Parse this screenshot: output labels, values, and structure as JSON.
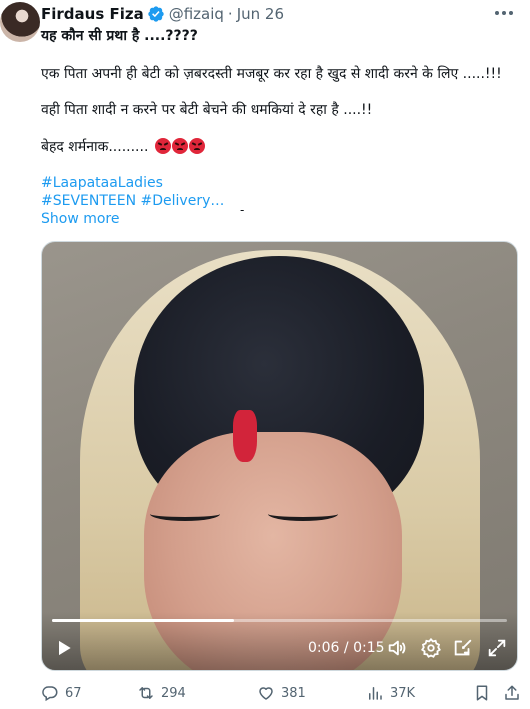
{
  "tweet": {
    "author_name": "Firdaus Fiza",
    "handle": "@fizaiq",
    "separator": "·",
    "date": "Jun 26",
    "line1": "यह कौन सी प्रथा  है ....????",
    "line2": "एक पिता अपनी ही बेटी को ज़बरदस्ती मजबूर कर रहा है खुद से शादी करने के लिए .....!!!",
    "line3": "वही पिता शादी न करने पर बेटी बेचने की धमकियां दे रहा है ....!!",
    "line4": "बेहद शर्मनाक.........",
    "hashtags_line1": "#LaapataaLadies",
    "hashtags_line2": "#SEVENTEEN #Delivery…",
    "show_more": "Show more",
    "stray_mark": "-"
  },
  "video": {
    "current_time": "0:06",
    "time_separator": " / ",
    "duration": "0:15",
    "progress_fraction": 0.4
  },
  "actions": {
    "replies": "67",
    "reposts": "294",
    "likes": "381",
    "views": "37K"
  },
  "colors": {
    "accent": "#1d9bf0",
    "muted": "#536471",
    "text": "#0f1419",
    "verified": "#1d9bf0"
  },
  "icons": [
    "verified-badge-icon",
    "more-icon",
    "angry-face-emoji-icon",
    "play-icon",
    "volume-icon",
    "settings-icon",
    "pip-icon",
    "fullscreen-icon",
    "reply-icon",
    "repost-icon",
    "like-icon",
    "views-icon",
    "bookmark-icon",
    "share-icon"
  ]
}
